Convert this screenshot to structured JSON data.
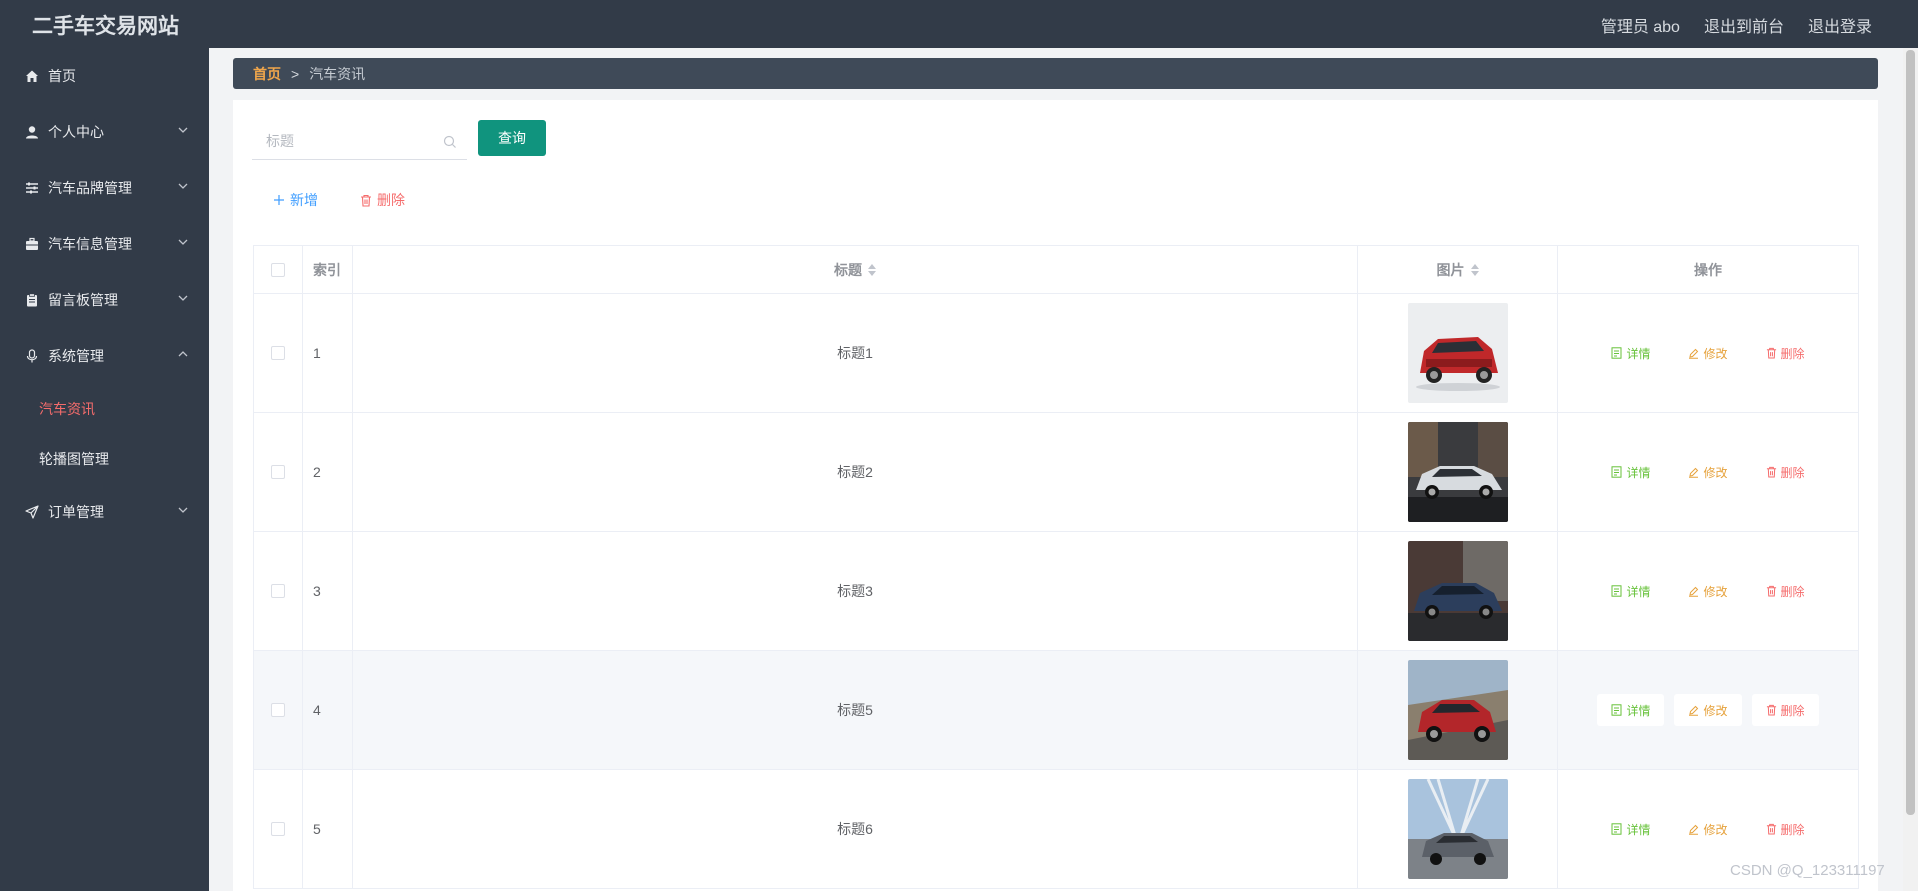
{
  "app": {
    "title": "二手车交易网站"
  },
  "top_links": {
    "admin": "管理员 abo",
    "front": "退出到前台",
    "logout": "退出登录"
  },
  "sidebar": {
    "items": [
      {
        "label": "首页",
        "icon": "home-icon"
      },
      {
        "label": "个人中心",
        "icon": "user-icon"
      },
      {
        "label": "汽车品牌管理",
        "icon": "sliders-icon"
      },
      {
        "label": "汽车信息管理",
        "icon": "briefcase-icon"
      },
      {
        "label": "留言板管理",
        "icon": "clipboard-icon"
      },
      {
        "label": "系统管理",
        "icon": "microphone-icon"
      },
      {
        "label": "订单管理",
        "icon": "send-icon"
      }
    ],
    "sub_items": [
      {
        "label": "汽车资讯",
        "active": true
      },
      {
        "label": "轮播图管理",
        "active": false
      }
    ]
  },
  "breadcrumb": {
    "home": "首页",
    "separator": ">",
    "current": "汽车资讯"
  },
  "search": {
    "placeholder": "标题",
    "value": "",
    "button": "查询"
  },
  "actions": {
    "add": "新增",
    "delete": "删除"
  },
  "table": {
    "columns": {
      "index": "索引",
      "title": "标题",
      "image": "图片",
      "ops": "操作"
    },
    "row_actions": {
      "detail": "详情",
      "edit": "修改",
      "remove": "删除"
    },
    "rows": [
      {
        "index": "1",
        "title": "标题1",
        "image": "red-suv"
      },
      {
        "index": "2",
        "title": "标题2",
        "image": "silver-sedan"
      },
      {
        "index": "3",
        "title": "标题3",
        "image": "dark-blue-sedan"
      },
      {
        "index": "4",
        "title": "标题5",
        "image": "red-pickup"
      },
      {
        "index": "5",
        "title": "标题6",
        "image": "gray-suv-bridge"
      }
    ]
  },
  "colors": {
    "topbar": "#323b48",
    "sidebar": "#323b48",
    "query_button": "#10947e",
    "active_sub": "#f56c6c",
    "breadcrumb_home": "#f0a64b"
  },
  "watermark": "CSDN @Q_123311197"
}
